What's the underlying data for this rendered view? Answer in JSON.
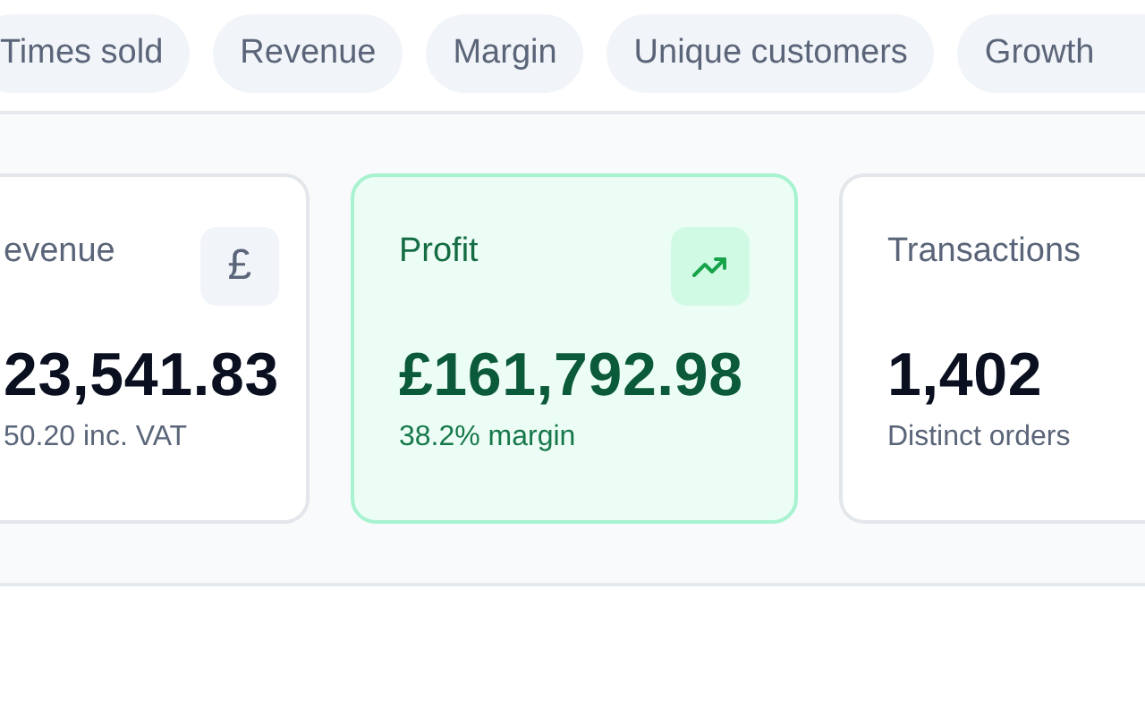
{
  "metric_pills": [
    {
      "label": "Times sold",
      "selected": false
    },
    {
      "label": "Revenue",
      "selected": false
    },
    {
      "label": "Margin",
      "selected": false
    },
    {
      "label": "Unique customers",
      "selected": false
    },
    {
      "label": "Growth",
      "selected": false
    }
  ],
  "cards": [
    {
      "label": "evenue",
      "kind": "plain",
      "icon": {
        "kind": "glyph",
        "text": "£"
      },
      "value": "23,541.83",
      "note": "50.20 inc. VAT"
    },
    {
      "label": "Profit",
      "kind": "highlight",
      "icon": {
        "kind": "trend-up"
      },
      "value": "£161,792.98",
      "note": "38.2% margin"
    },
    {
      "label": "Transactions",
      "kind": "plain",
      "value": "1,402",
      "note": "Distinct orders"
    }
  ]
}
